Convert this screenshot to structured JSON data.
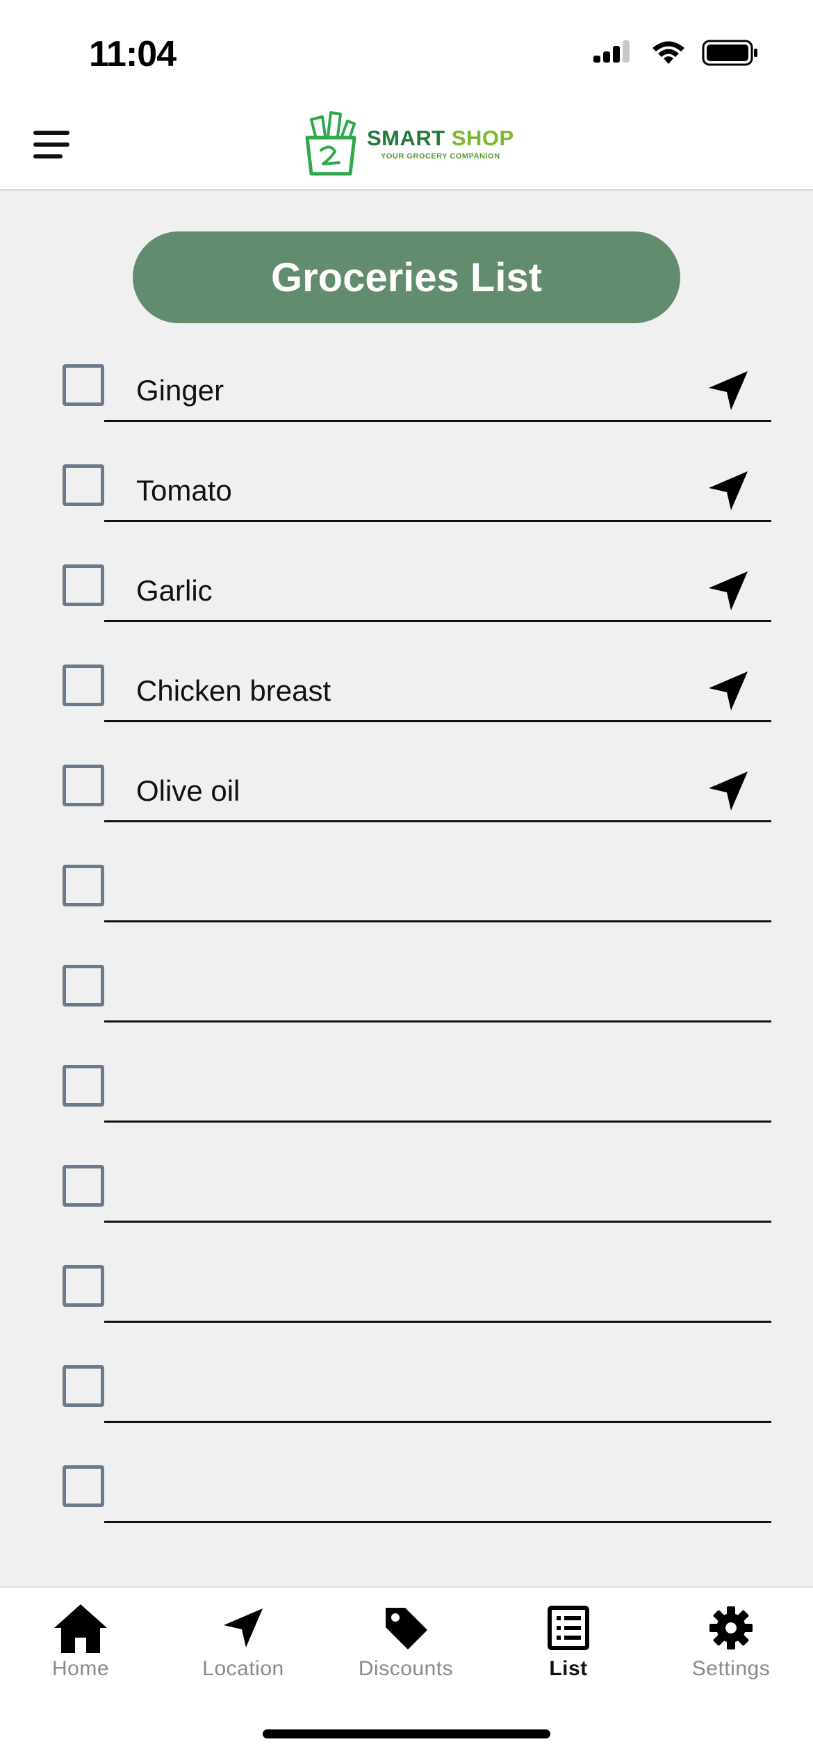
{
  "status_bar": {
    "time": "11:04"
  },
  "header": {
    "logo_title_part1": "SMART",
    "logo_title_part2": "SHOP",
    "logo_subtitle": "YOUR GROCERY COMPANION"
  },
  "page_title": "Groceries List",
  "items": [
    {
      "label": "Ginger",
      "checked": false,
      "has_location": true
    },
    {
      "label": "Tomato",
      "checked": false,
      "has_location": true
    },
    {
      "label": "Garlic",
      "checked": false,
      "has_location": true
    },
    {
      "label": "Chicken breast",
      "checked": false,
      "has_location": true
    },
    {
      "label": "Olive oil",
      "checked": false,
      "has_location": true
    },
    {
      "label": "",
      "checked": false,
      "has_location": false
    },
    {
      "label": "",
      "checked": false,
      "has_location": false
    },
    {
      "label": "",
      "checked": false,
      "has_location": false
    },
    {
      "label": "",
      "checked": false,
      "has_location": false
    },
    {
      "label": "",
      "checked": false,
      "has_location": false
    },
    {
      "label": "",
      "checked": false,
      "has_location": false
    },
    {
      "label": "",
      "checked": false,
      "has_location": false
    }
  ],
  "tabs": [
    {
      "label": "Home",
      "icon": "home-icon",
      "active": false
    },
    {
      "label": "Location",
      "icon": "location-arrow-icon",
      "active": false
    },
    {
      "label": "Discounts",
      "icon": "tag-icon",
      "active": false
    },
    {
      "label": "List",
      "icon": "list-icon",
      "active": true
    },
    {
      "label": "Settings",
      "icon": "gear-icon",
      "active": false
    }
  ],
  "colors": {
    "accent": "#638b6d",
    "logo_dark_green": "#1f7a3a",
    "logo_light_green": "#7ab82e",
    "checkbox_border": "#6a7a8a"
  }
}
